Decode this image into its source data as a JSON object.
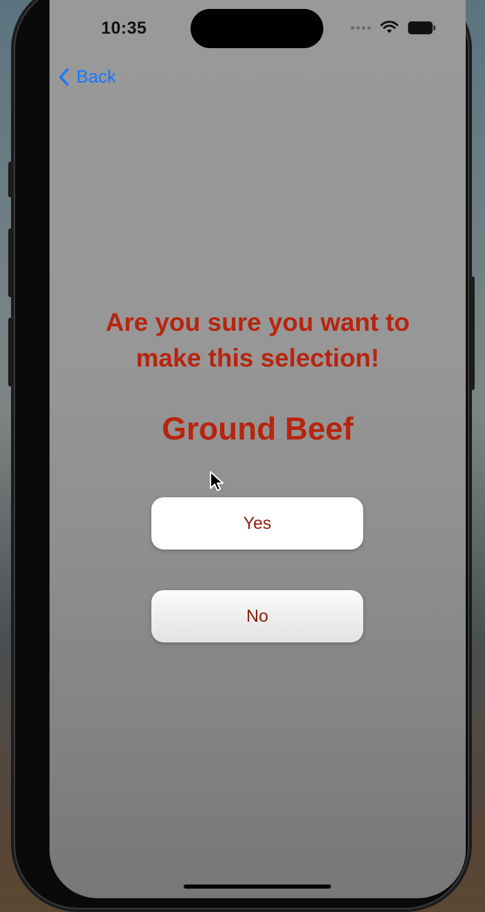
{
  "status_bar": {
    "time": "10:35",
    "icons": [
      "signal-dots-icon",
      "wifi-icon",
      "battery-icon"
    ]
  },
  "nav": {
    "back_label": "Back",
    "back_icon": "chevron-left-icon"
  },
  "confirm": {
    "prompt_line1": "Are you sure you want to",
    "prompt_line2": "make this selection!",
    "item": "Ground Beef",
    "yes_label": "Yes",
    "no_label": "No"
  },
  "colors": {
    "accent_text": "#b8240e",
    "link_blue": "#1677ff",
    "screen_bg": "#999999"
  }
}
